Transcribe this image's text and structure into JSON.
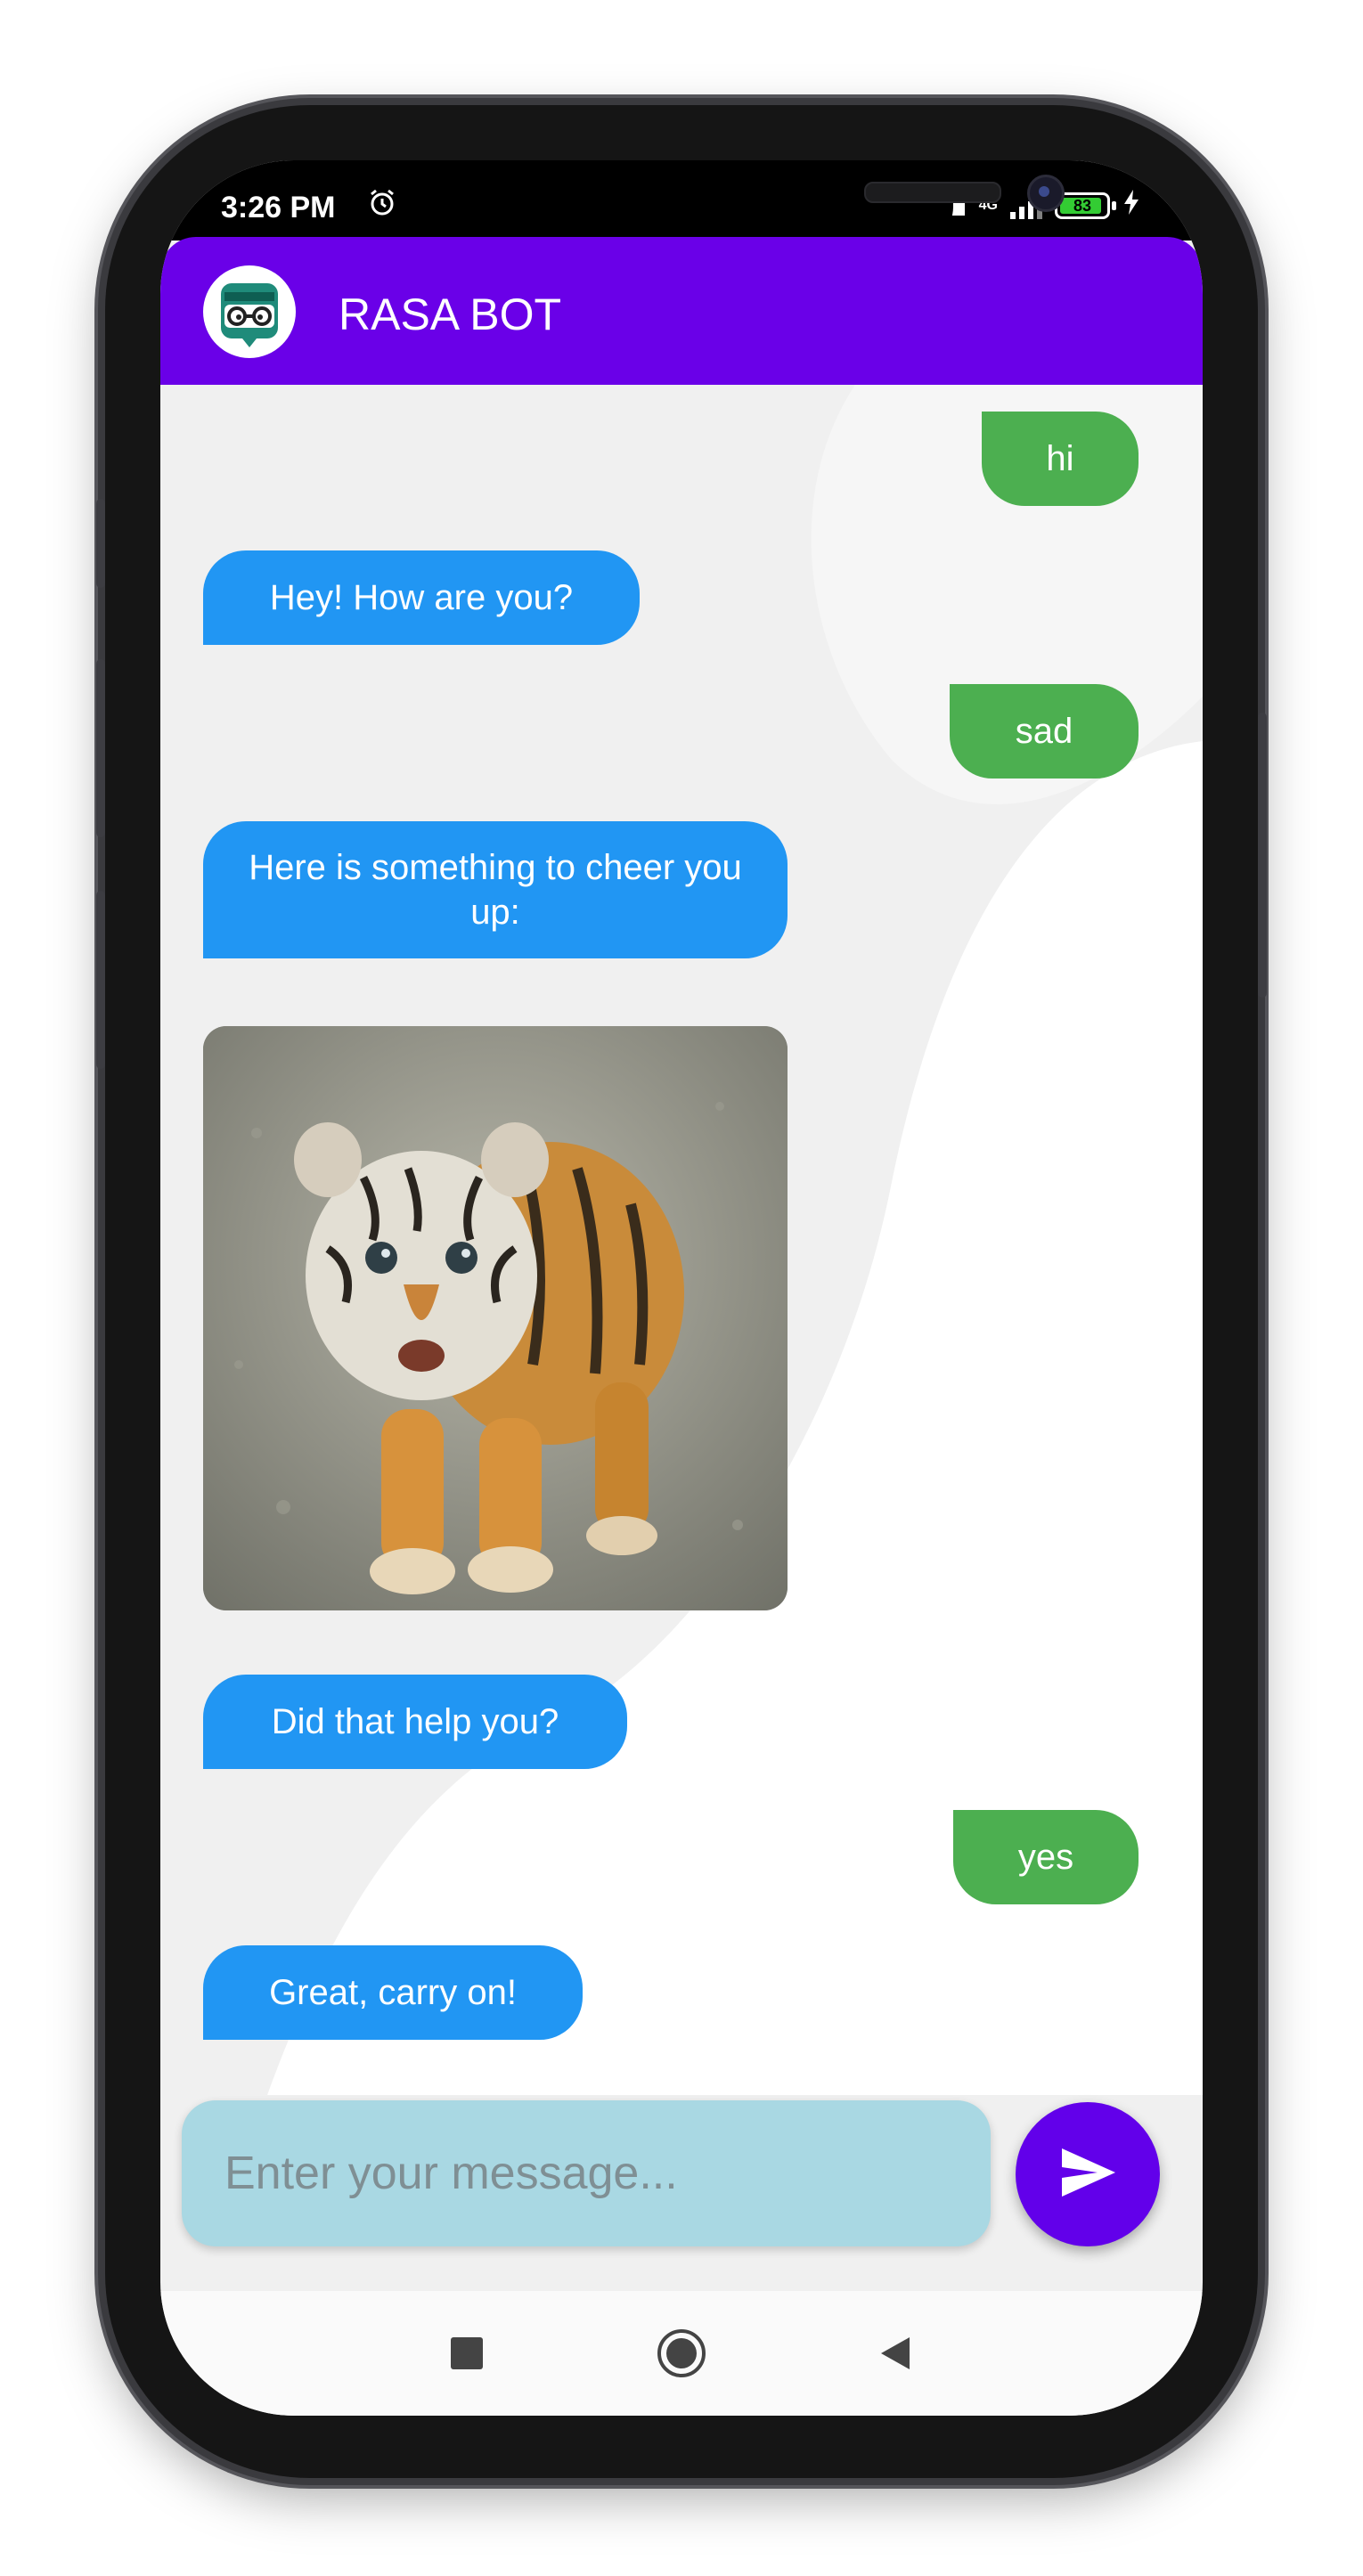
{
  "status_bar": {
    "time": "3:26 PM",
    "alarm_icon": "alarm-clock-icon",
    "network": "4G",
    "battery": "83"
  },
  "app_bar": {
    "title": "RASA BOT",
    "avatar_icon": "bot-avatar-icon",
    "color": "#6a00e8"
  },
  "messages": [
    {
      "sender": "user",
      "text": "hi"
    },
    {
      "sender": "bot",
      "text": "Hey! How are you?"
    },
    {
      "sender": "user",
      "text": "sad"
    },
    {
      "sender": "bot",
      "text": "Here is something to cheer you up:"
    },
    {
      "sender": "bot",
      "type": "image",
      "description": "tiger-cub-photo"
    },
    {
      "sender": "bot",
      "text": "Did that help you?"
    },
    {
      "sender": "user",
      "text": "yes"
    },
    {
      "sender": "bot",
      "text": "Great, carry on!"
    }
  ],
  "composer": {
    "placeholder": "Enter your message...",
    "send_icon": "send-icon"
  },
  "colors": {
    "user_bubble": "#4caf50",
    "bot_bubble": "#2196f3",
    "input_bg": "#a9d8e3",
    "send_button": "#6200ea"
  },
  "nav_bar": {
    "items": [
      "recents-square-icon",
      "home-circle-icon",
      "back-triangle-icon"
    ]
  }
}
